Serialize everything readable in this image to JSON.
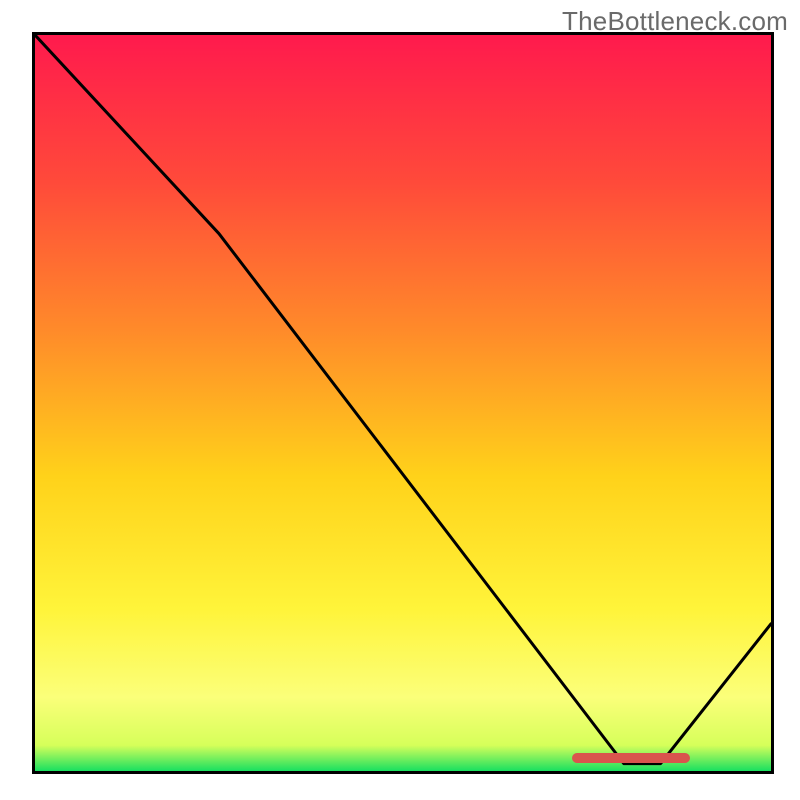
{
  "watermark": "TheBottleneck.com",
  "colors": {
    "frame": "#000000",
    "line": "#000000",
    "marker": "#d9544d",
    "gradient_stops": [
      {
        "offset": 0.0,
        "color": "#ff1a4d"
      },
      {
        "offset": 0.2,
        "color": "#ff4a3a"
      },
      {
        "offset": 0.4,
        "color": "#ff8a2a"
      },
      {
        "offset": 0.6,
        "color": "#ffd21a"
      },
      {
        "offset": 0.78,
        "color": "#fff43a"
      },
      {
        "offset": 0.9,
        "color": "#fbff7a"
      },
      {
        "offset": 0.965,
        "color": "#d6ff5a"
      },
      {
        "offset": 1.0,
        "color": "#18e060"
      }
    ]
  },
  "chart_data": {
    "type": "line",
    "title": "",
    "xlabel": "",
    "ylabel": "",
    "xlim": [
      0,
      100
    ],
    "ylim": [
      0,
      100
    ],
    "grid": false,
    "legend": false,
    "x": [
      0,
      25,
      80,
      85,
      100
    ],
    "values": [
      100,
      73,
      1,
      1,
      20
    ],
    "marker": {
      "x_start": 73,
      "x_end": 89,
      "y": 1.7
    }
  }
}
